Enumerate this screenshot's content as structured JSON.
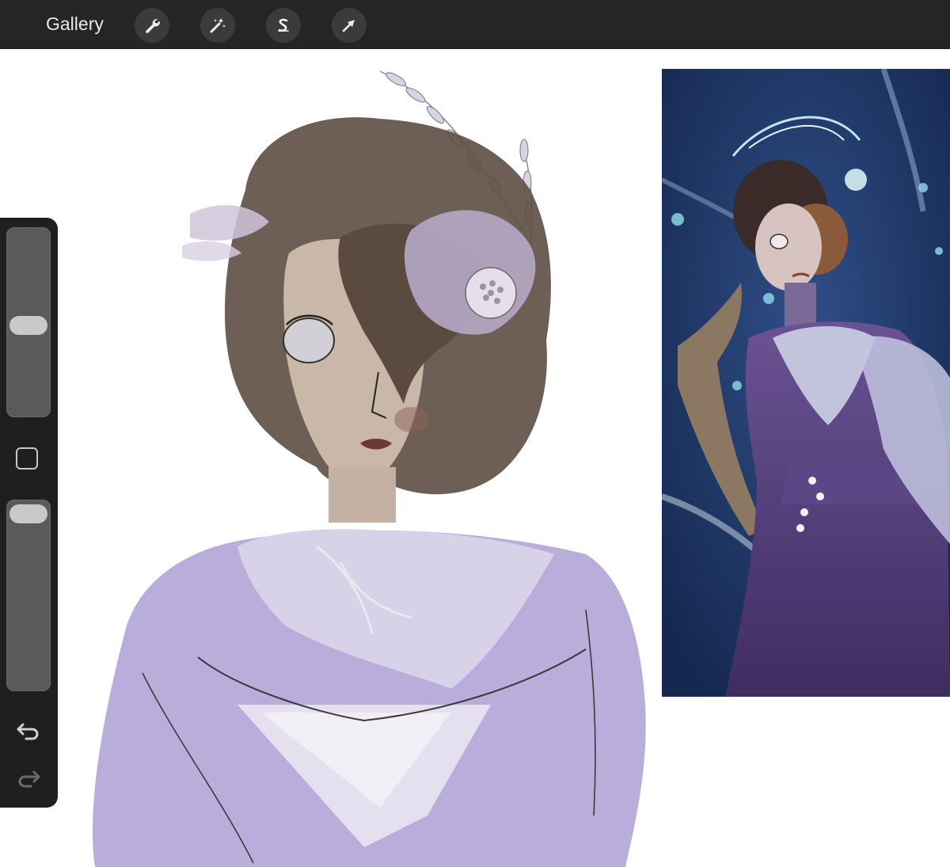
{
  "topbar": {
    "gallery_label": "Gallery",
    "tools": [
      {
        "name": "actions",
        "icon": "wrench-icon"
      },
      {
        "name": "adjustments",
        "icon": "magic-wand-icon"
      },
      {
        "name": "selection",
        "icon": "selection-s-icon"
      },
      {
        "name": "transform",
        "icon": "arrow-cursor-icon"
      }
    ]
  },
  "sidebar": {
    "brush_size_level": 0.45,
    "opacity_level": 0.05,
    "modify_icon": "square-icon",
    "undo_icon": "undo-arrow-icon",
    "redo_icon": "redo-arrow-icon"
  },
  "canvas": {
    "drawing": "sketch-portrait",
    "reference": "reference-image"
  },
  "colors": {
    "topbar": "#252525",
    "sidebar": "#1f1f1f",
    "hair": "#5e4e44",
    "skin": "#c9b7a8",
    "dress": "#b3a8d8",
    "reference_bg": "#1f3a6b"
  }
}
